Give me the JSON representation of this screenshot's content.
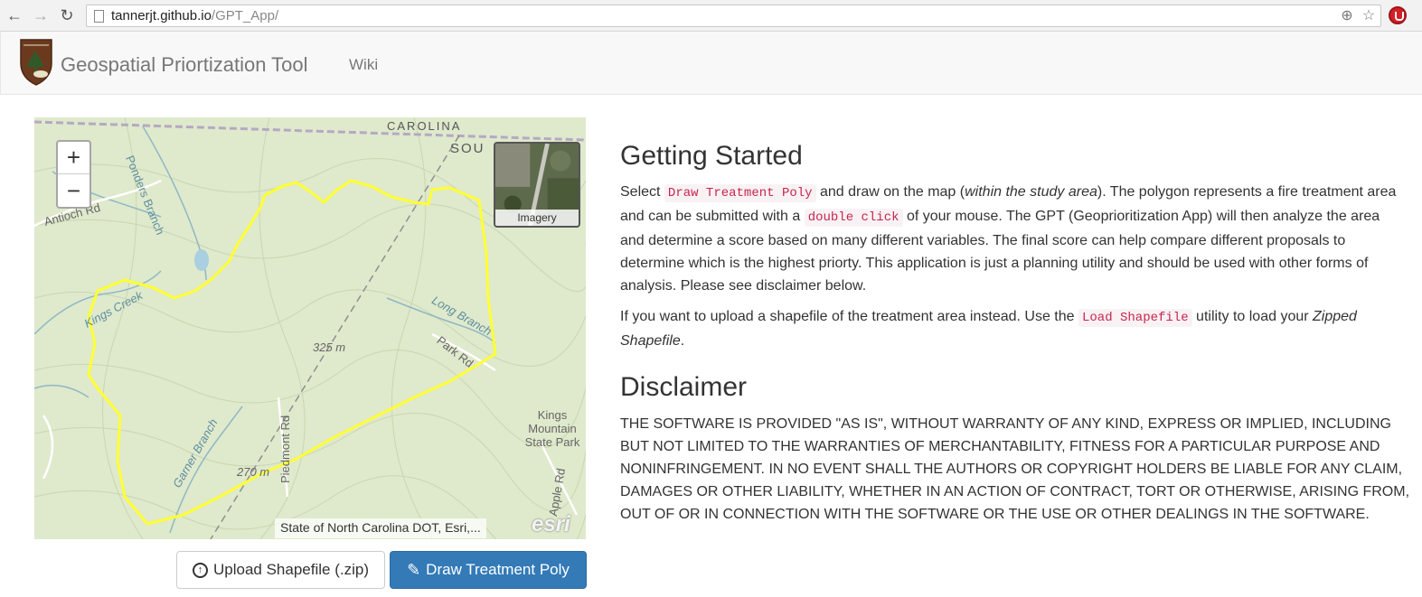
{
  "browser": {
    "url_host": "tannerjt.github.io",
    "url_path": "/GPT_App/"
  },
  "navbar": {
    "brand": "Geospatial Priortization Tool",
    "wiki": "Wiki"
  },
  "map": {
    "zoom_in": "+",
    "zoom_out": "−",
    "imagery_label": "Imagery",
    "attribution": "State of North Carolina DOT, Esri,...",
    "esri_logo": "esri",
    "labels": {
      "state": "CAROLINA",
      "south": "SOU",
      "ponders": "Ponders Branch",
      "antioch": "Antioch Rd",
      "kings_creek": "Kings Creek",
      "long_branch": "Long Branch",
      "park_rd": "Park Rd",
      "elev_325": "325 m",
      "elev_270": "270 m",
      "piedmont": "Piedmont Rd",
      "garner": "Garner Branch",
      "kings_mountain": "Kings Mountain State Park",
      "apple_rd": "Apple Rd"
    }
  },
  "buttons": {
    "upload": "Upload Shapefile (.zip)",
    "draw": "Draw Treatment Poly"
  },
  "content": {
    "getting_started": "Getting Started",
    "p1_a": "Select ",
    "p1_code1": "Draw Treatment Poly",
    "p1_b": " and draw on the map (",
    "p1_em": "within the study area",
    "p1_c": "). The polygon represents a fire treatment area and can be submitted with a ",
    "p1_code2": "double click",
    "p1_d": " of your mouse. The GPT (Geoprioritization App) will then analyze the area and determine a score based on many different variables. The final score can help compare different proposals to determine which is the highest priorty. This application is just a planning utility and should be used with other forms of analysis. Please see disclaimer below.",
    "p2_a": "If you want to upload a shapefile of the treatment area instead. Use the ",
    "p2_code": "Load Shapefile",
    "p2_b": " utility to load your ",
    "p2_em": "Zipped Shapefile",
    "p2_c": ".",
    "disclaimer_title": "Disclaimer",
    "disclaimer_text": "THE SOFTWARE IS PROVIDED \"AS IS\", WITHOUT WARRANTY OF ANY KIND, EXPRESS OR IMPLIED, INCLUDING BUT NOT LIMITED TO THE WARRANTIES OF MERCHANTABILITY, FITNESS FOR A PARTICULAR PURPOSE AND NONINFRINGEMENT. IN NO EVENT SHALL THE AUTHORS OR COPYRIGHT HOLDERS BE LIABLE FOR ANY CLAIM, DAMAGES OR OTHER LIABILITY, WHETHER IN AN ACTION OF CONTRACT, TORT OR OTHERWISE, ARISING FROM, OUT OF OR IN CONNECTION WITH THE SOFTWARE OR THE USE OR OTHER DEALINGS IN THE SOFTWARE."
  },
  "colors": {
    "primary": "#337ab7",
    "polygon": "#ffff33",
    "code": "#c7254e"
  }
}
